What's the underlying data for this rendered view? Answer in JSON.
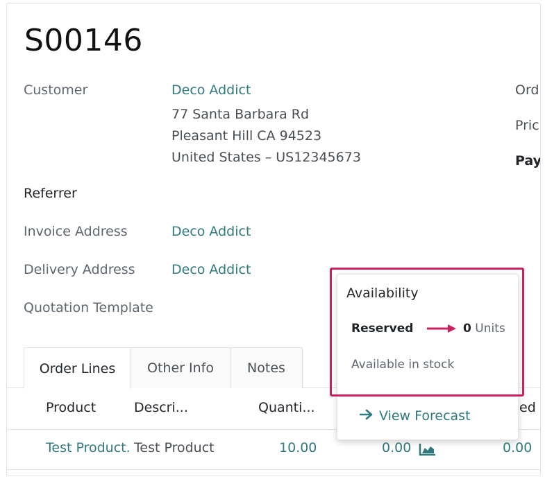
{
  "order": {
    "name": "S00146"
  },
  "fields": {
    "customer_label": "Customer",
    "customer_name": "Deco Addict",
    "address_line1": "77 Santa Barbara Rd",
    "address_line2": "Pleasant Hill CA 94523",
    "address_line3": "United States – US12345673",
    "referrer_label": "Referrer",
    "invoice_label": "Invoice Address",
    "invoice_value": "Deco Addict",
    "delivery_label": "Delivery Address",
    "delivery_value": "Deco Addict",
    "template_label": "Quotation Template"
  },
  "right_fields_cut": {
    "order": "Ord",
    "price": "Pric",
    "pay": "Pay"
  },
  "tabs": [
    {
      "label": "Order Lines",
      "active": true
    },
    {
      "label": "Other Info",
      "active": false
    },
    {
      "label": "Notes",
      "active": false
    }
  ],
  "table": {
    "headers": {
      "product": "Product",
      "description": "Descri...",
      "quantity": "Quanti...",
      "delivered_cut": "ed"
    },
    "rows": [
      {
        "product": "Test Product.",
        "description": "Test Product",
        "quantity": "10.00",
        "delivered": "0.00",
        "invoiced": "0.00"
      }
    ]
  },
  "availability_popover": {
    "title": "Availability",
    "reserved_label": "Reserved",
    "reserved_qty": "0",
    "reserved_unit": "Units",
    "stock_status": "Available in stock",
    "forecast_link": "View Forecast"
  },
  "colors": {
    "link": "#2f7a7e",
    "highlight": "#c9215f"
  },
  "icons": {
    "forecast_chart": "area-chart-icon",
    "forecast_arrow": "arrow-right-icon"
  }
}
